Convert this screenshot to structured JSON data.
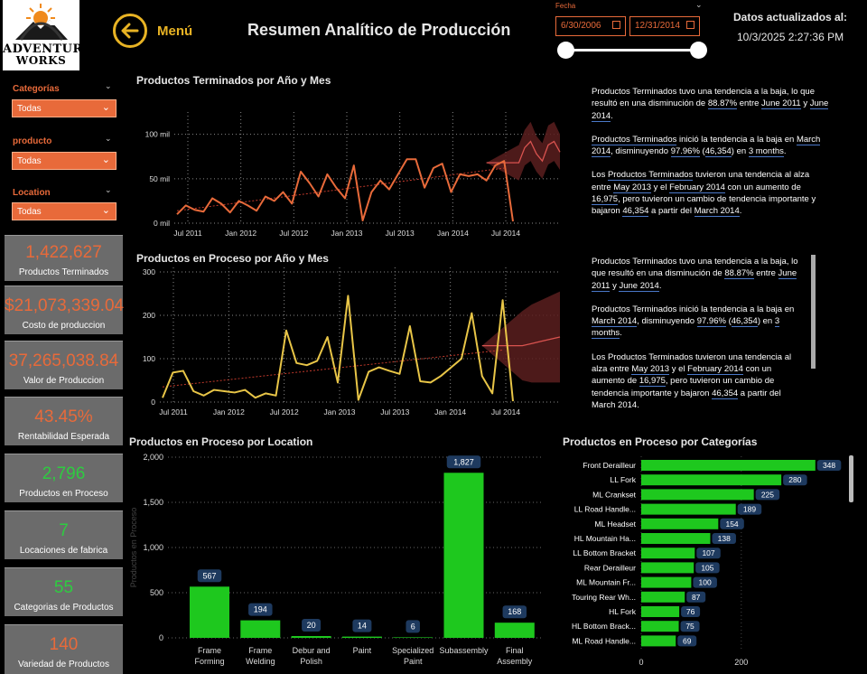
{
  "logo": {
    "line1": "ADVENTURE",
    "line2": "WORKS"
  },
  "header": {
    "back_label": "Menú",
    "title": "Resumen Analítico de Producción",
    "date_label": "Fecha",
    "date_from": "6/30/2006",
    "date_to": "12/31/2014",
    "updated_label": "Datos actualizados al:",
    "updated_value": "10/3/2025 2:27:36 PM"
  },
  "filters": [
    {
      "label": "Categorías",
      "value": "Todas"
    },
    {
      "label": "producto",
      "value": "Todas"
    },
    {
      "label": "Location",
      "value": "Todas"
    }
  ],
  "kpis": [
    {
      "value": "1,422,627",
      "label": "Productos Terminados",
      "color": "#e86a3a"
    },
    {
      "value": "$21,073,339.04",
      "label": "Costo de produccion",
      "color": "#e86a3a"
    },
    {
      "value": "37,265,038.84",
      "label": "Valor de Produccion",
      "color": "#e86a3a"
    },
    {
      "value": "43.45%",
      "label": "Rentabilidad Esperada",
      "color": "#e86a3a"
    },
    {
      "value": "2,796",
      "label": "Productos en Proceso",
      "color": "#2ecc40"
    },
    {
      "value": "7",
      "label": "Locaciones de fabrica",
      "color": "#2ecc40"
    },
    {
      "value": "55",
      "label": "Categorias de Productos",
      "color": "#2ecc40"
    },
    {
      "value": "140",
      "label": "Variedad de Productos",
      "color": "#e86a3a"
    }
  ],
  "narrative1": {
    "p1": [
      "Productos Terminados tuvo una tendencia a la baja, lo que resultó en una disminución de ",
      "88.87%",
      " entre ",
      "June 2011",
      " y ",
      "June 2014",
      "."
    ],
    "p2": [
      "",
      "Productos Terminados",
      " inició la tendencia a la baja en ",
      "March 2014",
      ", disminuyendo ",
      "97.96%",
      " (",
      "46,354",
      ") en ",
      "3 months",
      "."
    ],
    "p3": [
      "Los ",
      "Productos Terminados",
      " tuvieron una tendencia al alza entre ",
      "May 2013",
      " y el ",
      "February 2014",
      " con un aumento de ",
      "16,975",
      ", pero tuvieron un cambio de tendencia importante y bajaron ",
      "46,354",
      " a partir del ",
      "March 2014",
      "."
    ]
  },
  "narrative2": {
    "p1": [
      "Productos Terminados tuvo una tendencia a la baja, lo que resultó en una disminución de ",
      "88.87%",
      " entre ",
      "June 2011",
      " y ",
      "June 2014",
      "."
    ],
    "p2": [
      "",
      "March 2014",
      ", disminuyendo ",
      "97.96%",
      " (",
      "46,354",
      ") en ",
      "3 months",
      "."
    ],
    "p2_prefix": "Productos Terminados inició la tendencia a la baja en ",
    "p3": [
      "Los Productos Terminados tuvieron una tendencia al alza entre ",
      "May 2013",
      " y el ",
      "February 2014",
      " con un aumento de ",
      "16,975",
      ", pero tuvieron un cambio de tendencia importante y bajaron ",
      "46,354",
      " a partir del March 2014."
    ]
  },
  "chart_data": [
    {
      "id": "terminados",
      "type": "line",
      "title": "Productos Terminados por Año y Mes",
      "x_ticks": [
        "Jul 2011",
        "Jan 2012",
        "Jul 2012",
        "Jan 2013",
        "Jul 2013",
        "Jan 2014",
        "Jul 2014"
      ],
      "y_ticks": [
        "0 mil",
        "50 mil",
        "100 mil"
      ],
      "ylim": [
        0,
        120000
      ],
      "color": "#e86a3a",
      "values": [
        10000,
        20000,
        15000,
        13000,
        28000,
        22000,
        12000,
        25000,
        20000,
        14000,
        30000,
        25000,
        35000,
        22000,
        58000,
        45000,
        30000,
        55000,
        40000,
        28000,
        65000,
        3000,
        35000,
        48000,
        38000,
        55000,
        72000,
        72000,
        40000,
        62000,
        67000,
        35000,
        55000,
        53000,
        55000,
        48000,
        65000,
        70000,
        2000
      ],
      "forecast": [
        68000,
        85000,
        92000,
        78000,
        70000,
        88000,
        92000,
        80000
      ],
      "forecast_band": [
        20000,
        20000,
        22000,
        20000,
        20000,
        22000,
        22000,
        20000
      ],
      "trend": [
        14000,
        62000
      ]
    },
    {
      "id": "proceso",
      "type": "line",
      "title": "Productos en Proceso por Año y Mes",
      "x_ticks": [
        "Jul 2011",
        "Jan 2012",
        "Jul 2012",
        "Jan 2013",
        "Jul 2013",
        "Jan 2014",
        "Jul 2014"
      ],
      "y_ticks": [
        "0",
        "100",
        "200",
        "300"
      ],
      "ylim": [
        0,
        300
      ],
      "color": "#e8c547",
      "values": [
        10,
        68,
        72,
        25,
        15,
        28,
        25,
        22,
        28,
        10,
        20,
        15,
        165,
        90,
        85,
        95,
        150,
        45,
        245,
        5,
        70,
        80,
        72,
        65,
        175,
        48,
        45,
        60,
        80,
        100,
        205,
        60,
        20,
        235,
        2
      ],
      "forecast": [
        130,
        135,
        140,
        145,
        150
      ],
      "forecast_band": [
        80,
        90,
        95,
        100,
        105
      ],
      "trend": [
        35,
        120
      ]
    },
    {
      "id": "location",
      "type": "bar",
      "title": "Productos en Proceso por Location",
      "ylabel": "Productos en Proceso",
      "categories": [
        "Frame Forming",
        "Frame Welding",
        "Debur and Polish",
        "Paint",
        "Specialized Paint",
        "Subassembly",
        "Final Assembly"
      ],
      "values": [
        567,
        194,
        20,
        14,
        6,
        1827,
        168
      ],
      "labels": [
        "567",
        "194",
        "20",
        "14",
        "6",
        "1,827",
        "168"
      ],
      "y_ticks": [
        "0",
        "500",
        "1,000",
        "1,500",
        "2,000"
      ],
      "ylim": [
        0,
        2000
      ],
      "color": "#1ec81e"
    },
    {
      "id": "categorias",
      "type": "bar",
      "title": "Productos en Proceso por Categorías",
      "categories": [
        "Front Derailleur",
        "LL Fork",
        "ML Crankset",
        "LL Road Handle...",
        "ML Headset",
        "HL Mountain Ha...",
        "LL Bottom Bracket",
        "Rear Derailleur",
        "ML Mountain Fr...",
        "Touring Rear Wh...",
        "HL Fork",
        "HL Bottom Brack...",
        "ML Road Handle..."
      ],
      "values": [
        348,
        280,
        225,
        189,
        154,
        138,
        107,
        105,
        100,
        87,
        76,
        75,
        69
      ],
      "x_ticks": [
        "0",
        "200"
      ],
      "xlim": [
        0,
        370
      ],
      "color": "#1ec81e"
    }
  ]
}
